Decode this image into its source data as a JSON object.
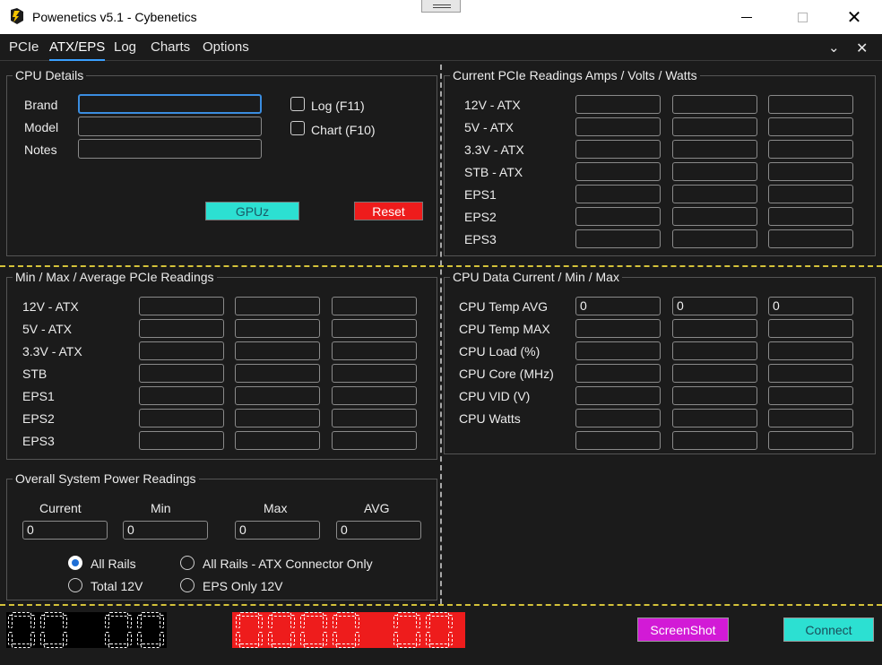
{
  "window": {
    "title": "Powenetics v5.1 - Cybenetics"
  },
  "tabs": [
    "PCIe",
    "ATX/EPS",
    "Log",
    "Charts",
    "Options"
  ],
  "active_tab": "ATX/EPS",
  "cpu_details": {
    "title": "CPU Details",
    "brand_label": "Brand",
    "model_label": "Model",
    "notes_label": "Notes",
    "brand_value": "",
    "model_value": "",
    "notes_value": "",
    "log_label": "Log (F11)",
    "chart_label": "Chart (F10)",
    "gpuz_label": "GPUz",
    "reset_label": "Reset"
  },
  "current_pcie": {
    "title": "Current PCIe Readings Amps / Volts / Watts",
    "rows": [
      "12V - ATX",
      "5V - ATX",
      "3.3V - ATX",
      "STB - ATX",
      "EPS1",
      "EPS2",
      "EPS3"
    ]
  },
  "minmax_pcie": {
    "title": "Min / Max / Average PCIe Readings",
    "rows": [
      "12V - ATX",
      "5V - ATX",
      "3.3V - ATX",
      "STB",
      "EPS1",
      "EPS2",
      "EPS3"
    ]
  },
  "cpu_data": {
    "title": "CPU Data Current / Min / Max",
    "rows": [
      "CPU Temp AVG",
      "CPU Temp MAX",
      "CPU Load (%)",
      "CPU Core (MHz)",
      "CPU VID (V)",
      "CPU Watts",
      ""
    ],
    "temp_avg_values": [
      "0",
      "0",
      "0"
    ]
  },
  "system_power": {
    "title": "Overall System Power Readings",
    "headers": [
      "Current",
      "Min",
      "Max",
      "AVG"
    ],
    "values": [
      "0",
      "0",
      "0",
      "0"
    ],
    "radio_all_rails": "All Rails",
    "radio_total_12v": "Total 12V",
    "radio_atx_only": "All Rails - ATX Connector Only",
    "radio_eps_only": "EPS Only 12V",
    "selected": "All Rails"
  },
  "footer": {
    "screenshot_label": "ScreenShot",
    "connect_label": "Connect",
    "timer_display": "00 00",
    "counter_display": "0000 00"
  },
  "colors": {
    "accent": "#3aa0ff",
    "gpuz_button": "#2ce0d2",
    "reset_button": "#ee1c1c",
    "screenshot_button": "#d21ad6",
    "connect_button": "#2ce0d2",
    "separator": "#d4c23a",
    "counter_panel": "#ee1c1c"
  }
}
